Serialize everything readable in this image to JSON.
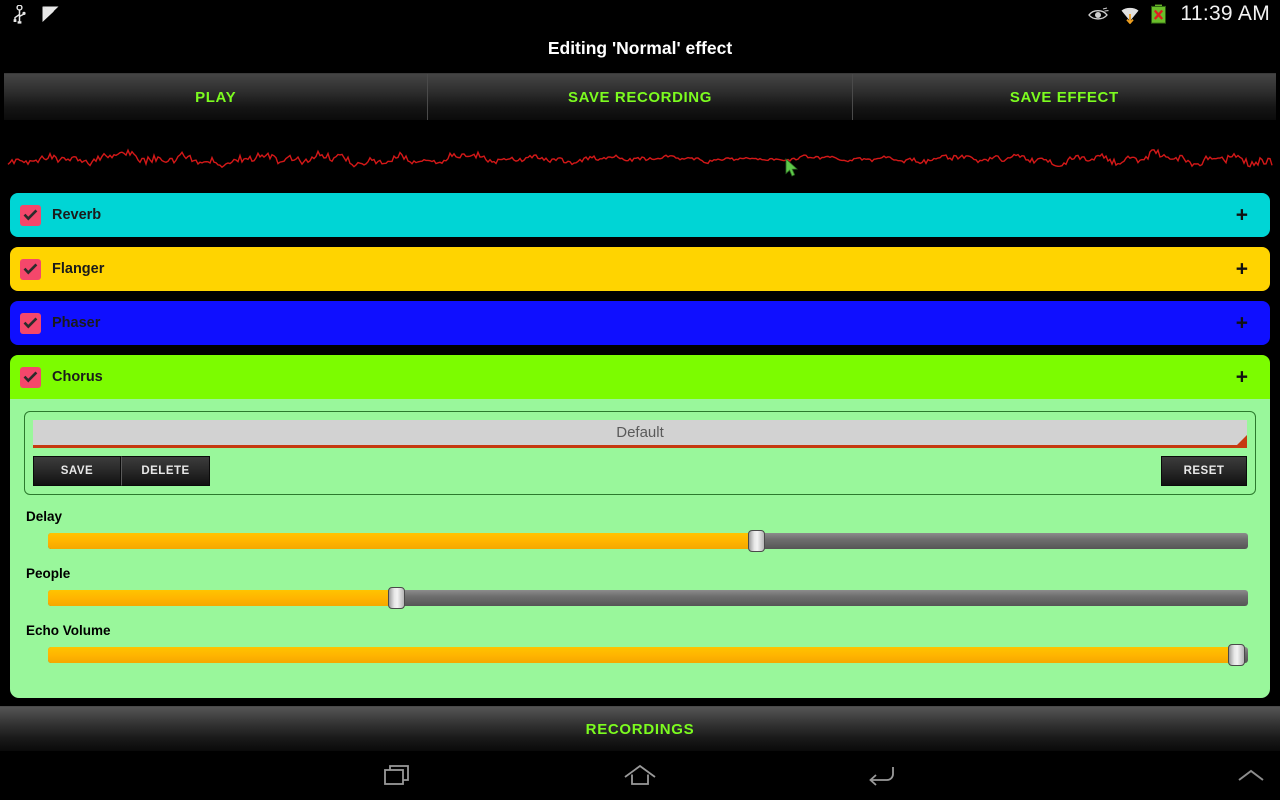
{
  "statusbar": {
    "icons_left": [
      "usb-icon",
      "check-flag-icon"
    ],
    "icons_right": [
      "eye-icon",
      "wifi-transfer-icon",
      "battery-error-icon"
    ],
    "time": "11:39 AM"
  },
  "title": "Editing 'Normal' effect",
  "toolbar": {
    "play_label": "PLAY",
    "save_recording_label": "SAVE RECORDING",
    "save_effect_label": "SAVE EFFECT",
    "accent_green": "#7cfc1f"
  },
  "waveform": {
    "line_color": "#d41818",
    "background": "#000000",
    "cursor": "pointer-arrow"
  },
  "effects": [
    {
      "name": "Reverb",
      "checked": true,
      "color": "#00d5d5",
      "expand": "+",
      "expanded": false
    },
    {
      "name": "Flanger",
      "checked": true,
      "color": "#ffd400",
      "expand": "+",
      "expanded": false
    },
    {
      "name": "Phaser",
      "checked": true,
      "color": "#0f0fff",
      "expand": "+",
      "expanded": false
    },
    {
      "name": "Chorus",
      "checked": true,
      "color": "#7cfc00",
      "expand": "+",
      "expanded": true
    }
  ],
  "chorus_panel": {
    "background": "#99f79b",
    "preset_value": "Default",
    "save_label": "SAVE",
    "delete_label": "DELETE",
    "reset_label": "RESET",
    "sliders": [
      {
        "label": "Delay",
        "percent": 59
      },
      {
        "label": "People",
        "percent": 29
      },
      {
        "label": "Echo Volume",
        "percent": 99
      }
    ]
  },
  "bottom": {
    "recordings_label": "RECORDINGS"
  },
  "navbar": {
    "items": [
      "recent-apps-icon",
      "home-icon",
      "back-icon",
      "chevron-up-icon"
    ]
  }
}
